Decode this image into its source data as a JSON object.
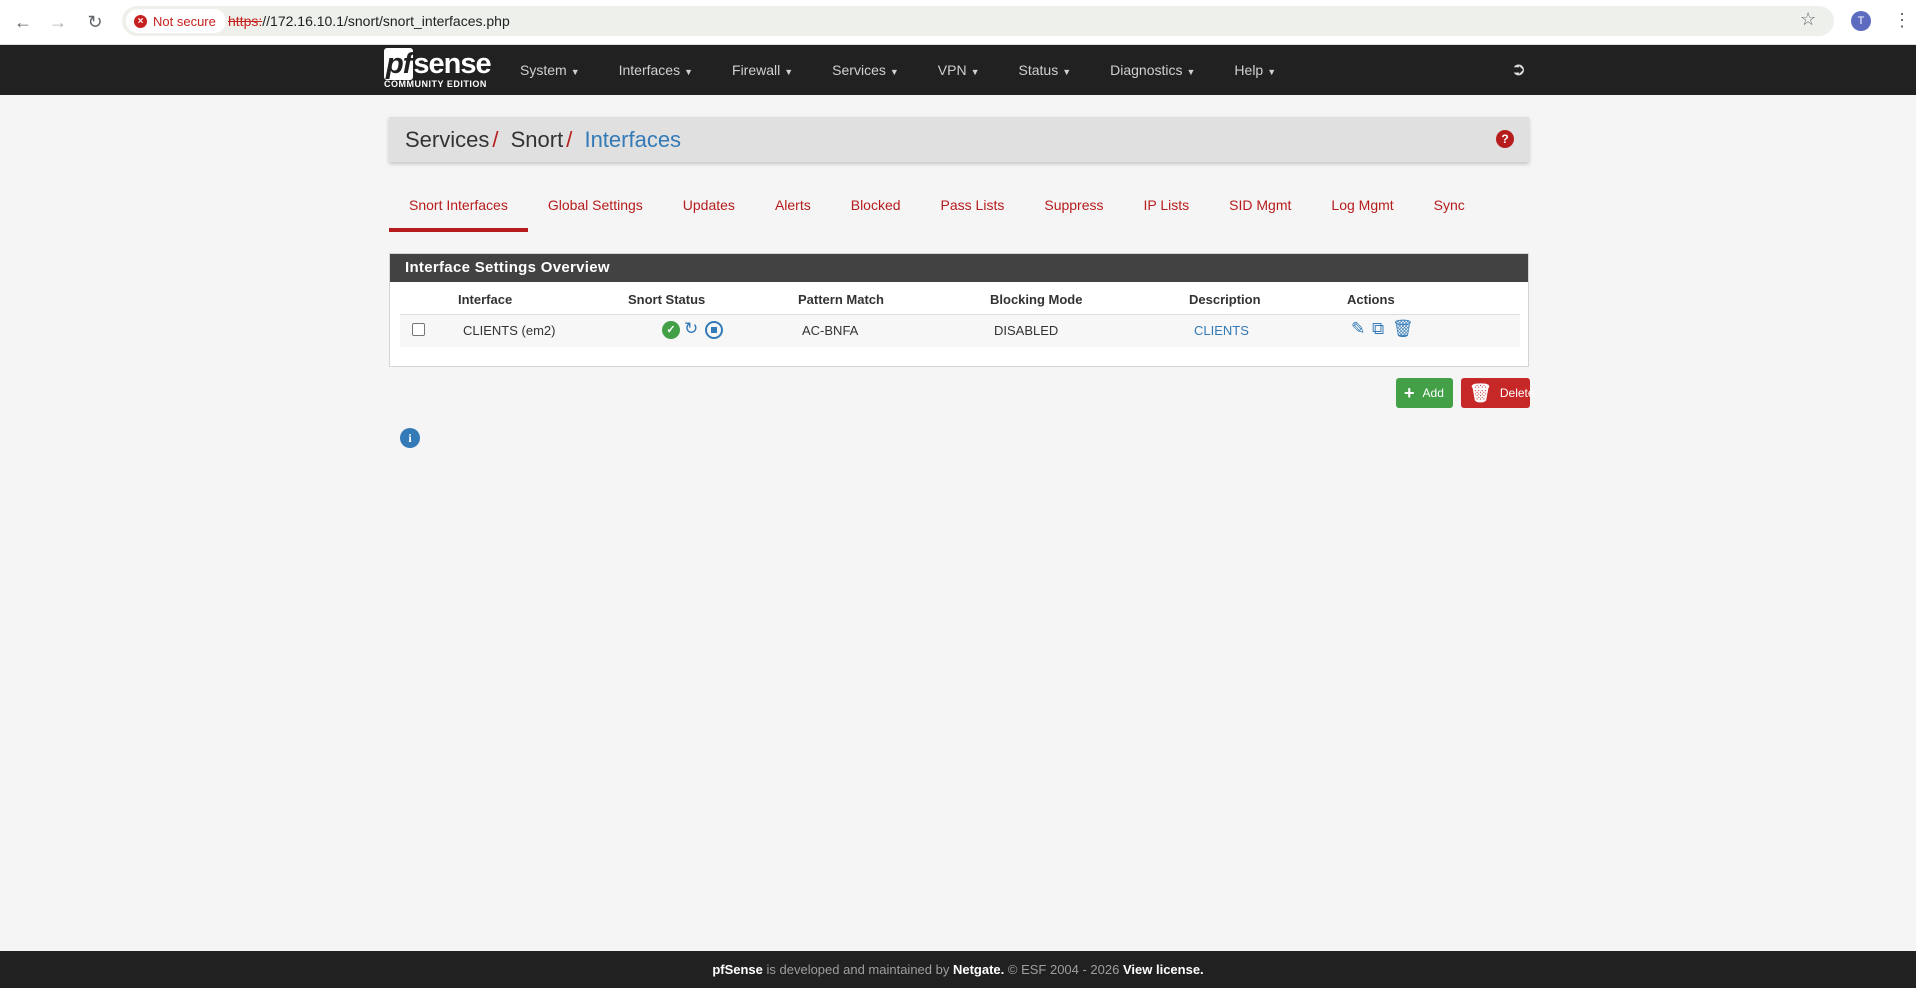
{
  "browser": {
    "security_label": "Not secure",
    "url_scheme": "https:",
    "url_rest": "//172.16.10.1/snort/snort_interfaces.php",
    "profile_initial": "T"
  },
  "navbar": {
    "logo_main": "sense",
    "logo_pf": "pf",
    "logo_sub": "COMMUNITY EDITION",
    "menu": [
      "System",
      "Interfaces",
      "Firewall",
      "Services",
      "VPN",
      "Status",
      "Diagnostics",
      "Help"
    ]
  },
  "breadcrumb": {
    "items": [
      "Services",
      "Snort",
      "Interfaces"
    ],
    "separator": "/"
  },
  "tabs": [
    "Snort Interfaces",
    "Global Settings",
    "Updates",
    "Alerts",
    "Blocked",
    "Pass Lists",
    "Suppress",
    "IP Lists",
    "SID Mgmt",
    "Log Mgmt",
    "Sync"
  ],
  "panel": {
    "title": "Interface Settings Overview",
    "columns": [
      "Interface",
      "Snort Status",
      "Pattern Match",
      "Blocking Mode",
      "Description",
      "Actions"
    ],
    "rows": [
      {
        "interface": "CLIENTS (em2)",
        "pattern_match": "AC-BNFA",
        "blocking_mode": "DISABLED",
        "description": "CLIENTS",
        "status_icons": [
          "check-circle-icon",
          "restart-icon",
          "stop-icon"
        ],
        "action_icons": [
          "edit-icon",
          "copy-icon",
          "trash-icon"
        ]
      }
    ]
  },
  "buttons": {
    "add": "Add",
    "delete": "Delete"
  },
  "footer": {
    "brand": "pfSense",
    "text1": " is developed and maintained by ",
    "company": "Netgate.",
    "text2": " © ESF 2004 - 2026 ",
    "license": "View license."
  },
  "colors": {
    "accent_red": "#b71c1c",
    "link_blue": "#337ab7",
    "navbar_bg": "#212121",
    "success_green": "#43a047"
  }
}
